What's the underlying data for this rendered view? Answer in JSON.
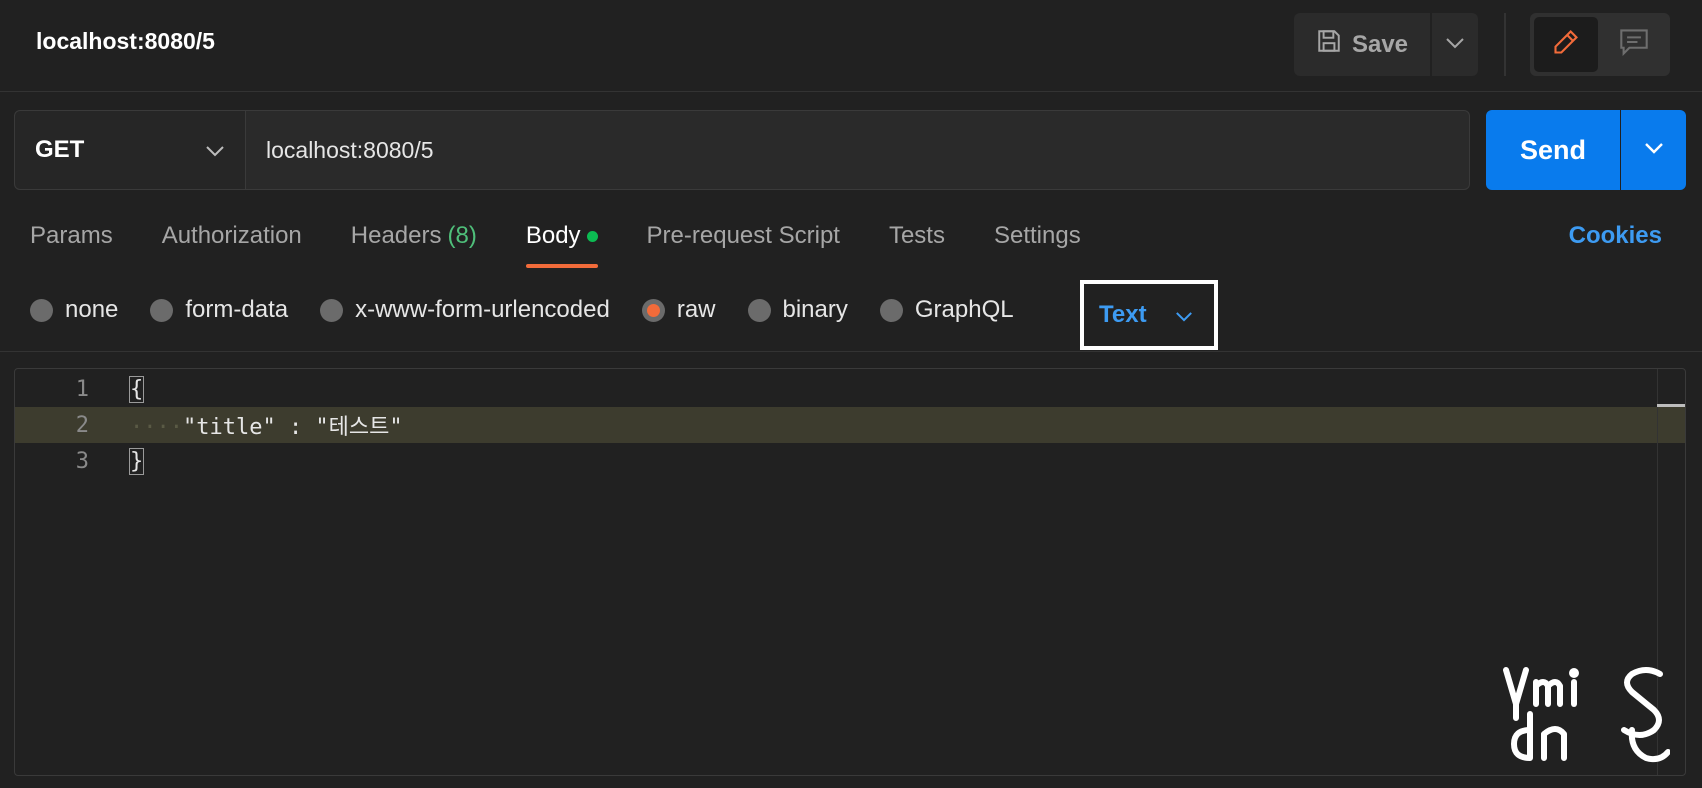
{
  "header": {
    "title": "localhost:8080/5",
    "save_label": "Save"
  },
  "request": {
    "method": "GET",
    "url": "localhost:8080/5",
    "send_label": "Send"
  },
  "tabs": [
    {
      "label": "Params"
    },
    {
      "label": "Authorization"
    },
    {
      "label": "Headers",
      "count": "(8)"
    },
    {
      "label": "Body",
      "active": true
    },
    {
      "label": "Pre-request Script"
    },
    {
      "label": "Tests"
    },
    {
      "label": "Settings"
    }
  ],
  "cookies_label": "Cookies",
  "body_types": [
    {
      "label": "none",
      "checked": false
    },
    {
      "label": "form-data",
      "checked": false
    },
    {
      "label": "x-www-form-urlencoded",
      "checked": false
    },
    {
      "label": "raw",
      "checked": true
    },
    {
      "label": "binary",
      "checked": false
    },
    {
      "label": "GraphQL",
      "checked": false
    }
  ],
  "raw_format": "Text",
  "editor": {
    "lines": [
      {
        "number": "1",
        "text": "{"
      },
      {
        "number": "2",
        "text": "\"title\" : \"테스트\""
      },
      {
        "number": "3",
        "text": "}"
      }
    ],
    "highlighted_line": 2
  },
  "watermark": "ymisdns",
  "colors": {
    "accent_blue": "#097bed",
    "link_blue": "#3d9bf2",
    "active_orange": "#f26b3a",
    "status_green": "#0cbb52"
  },
  "icons": [
    "save-icon",
    "chevron-down-icon",
    "pencil-icon",
    "comment-icon"
  ]
}
